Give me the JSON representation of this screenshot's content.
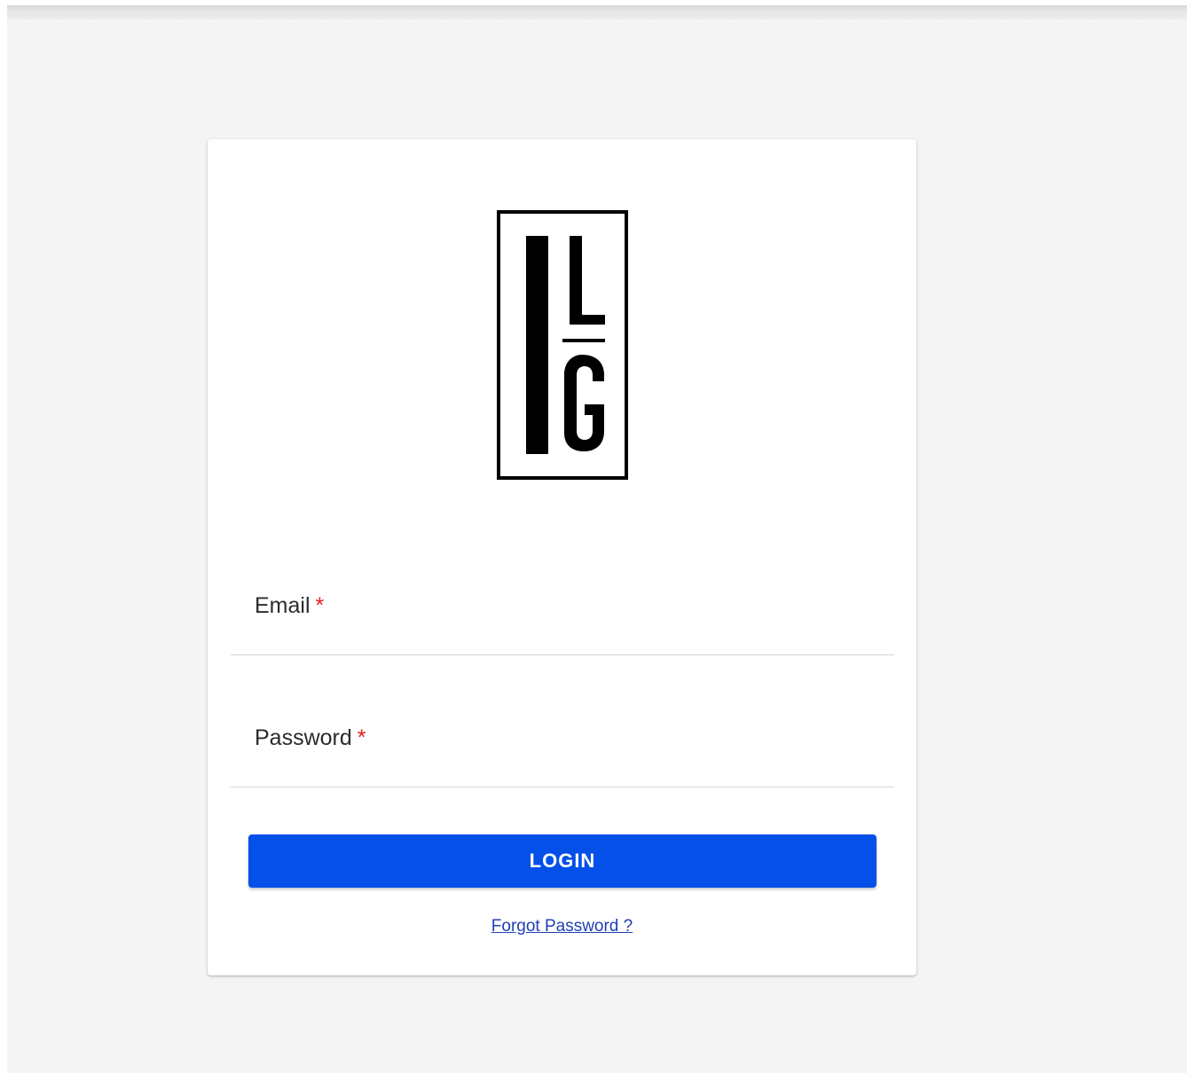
{
  "brand": {
    "logo_icon": "ilg-logo-icon",
    "logo_text": "ILG"
  },
  "form": {
    "email_label": "Email",
    "password_label": "Password",
    "required_marker": "*",
    "email_value": "",
    "password_value": ""
  },
  "actions": {
    "login_label": "LOGIN",
    "forgot_label": "Forgot Password ?"
  },
  "colors": {
    "background": "#f4f4f4",
    "card": "#ffffff",
    "primary": "#0450e8",
    "required": "#e02020",
    "link": "#1f3fb5"
  }
}
